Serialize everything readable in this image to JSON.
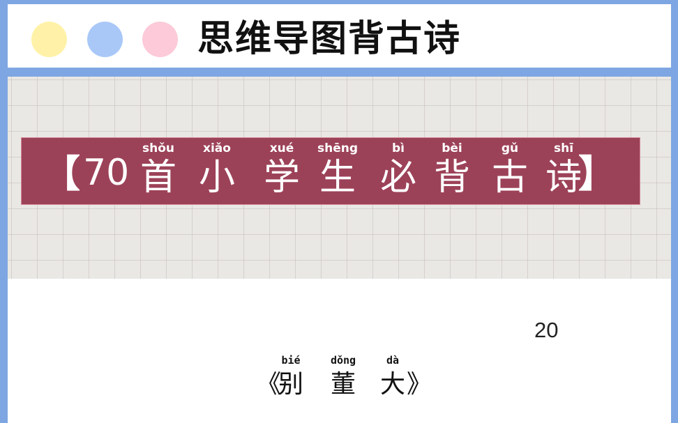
{
  "header": {
    "title": "思维导图背古诗",
    "dots": [
      {
        "name": "yellow",
        "color": "#fff2a8"
      },
      {
        "name": "blue",
        "color": "#a9c8f8"
      },
      {
        "name": "pink",
        "color": "#fccad8"
      }
    ]
  },
  "banner": {
    "open_bracket": "【",
    "close_bracket": "】",
    "number": "70",
    "chars": [
      {
        "pinyin": "shǒu",
        "hanzi": "首"
      },
      {
        "pinyin": "xiǎo",
        "hanzi": "小"
      },
      {
        "pinyin": "xué",
        "hanzi": "学"
      },
      {
        "pinyin": "shēng",
        "hanzi": "生"
      },
      {
        "pinyin": "bì",
        "hanzi": "必"
      },
      {
        "pinyin": "bèi",
        "hanzi": "背"
      },
      {
        "pinyin": "gǔ",
        "hanzi": "古"
      },
      {
        "pinyin": "shī",
        "hanzi": "诗"
      }
    ],
    "color": "#9c4258"
  },
  "content": {
    "page_number": "20",
    "poem_title": {
      "open": "《",
      "close": "》",
      "chars": [
        {
          "pinyin": "bié",
          "hanzi": "别"
        },
        {
          "pinyin": "dǒng",
          "hanzi": "董"
        },
        {
          "pinyin": "dà",
          "hanzi": "大"
        }
      ]
    }
  },
  "colors": {
    "frame": "#7ea6e2",
    "paper": "#e9e8e4"
  }
}
